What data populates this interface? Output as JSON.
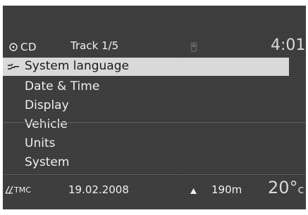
{
  "status_bar": {
    "source_icon": "cd-disc-icon",
    "source_label": "CD",
    "track": "Track 1/5",
    "phone_icon": "phone-icon",
    "clock": "4:01"
  },
  "menu": {
    "selected_icon": "settings-wrench-icon",
    "items": [
      {
        "label": "System language",
        "selected": true
      },
      {
        "label": "Date & Time",
        "selected": false
      },
      {
        "label": "Display",
        "selected": false
      },
      {
        "label": "Vehicle",
        "selected": false
      },
      {
        "label": "Units",
        "selected": false
      },
      {
        "label": "System",
        "selected": false
      }
    ]
  },
  "bottom_bar": {
    "tmc_icon": "tmc-road-icon",
    "tmc_label": "TMC",
    "date": "19.02.2008",
    "altitude_icon": "mountain-icon",
    "altitude": "190m",
    "temperature": "20°",
    "temperature_unit": "c"
  },
  "colors": {
    "screen_bg": "#3b3b3b",
    "text": "#f0f0f0",
    "highlight": "#d9d9d9"
  }
}
